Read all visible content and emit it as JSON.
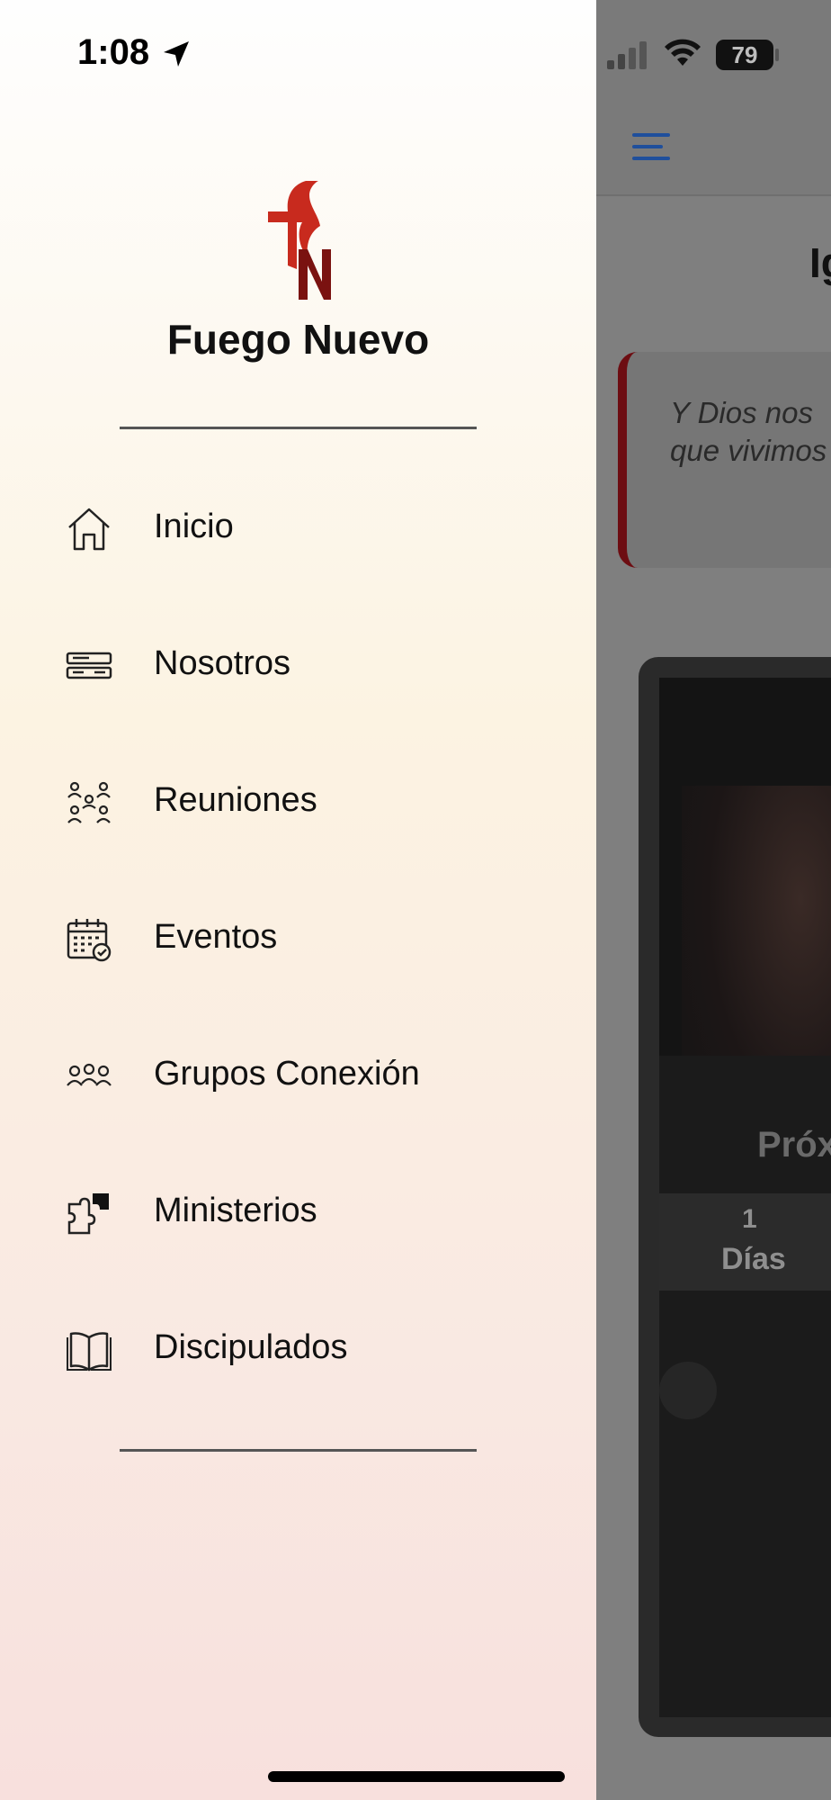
{
  "status_bar": {
    "time": "1:08",
    "battery": "79"
  },
  "drawer": {
    "brand_name": "Fuego Nuevo",
    "menu": [
      {
        "label": "Inicio",
        "icon": "home-icon"
      },
      {
        "label": "Nosotros",
        "icon": "about-icon"
      },
      {
        "label": "Reuniones",
        "icon": "people-network-icon"
      },
      {
        "label": "Eventos",
        "icon": "calendar-check-icon"
      },
      {
        "label": "Grupos Conexión",
        "icon": "group-icon"
      },
      {
        "label": "Ministerios",
        "icon": "puzzle-icon"
      },
      {
        "label": "Discipulados",
        "icon": "book-icon"
      }
    ]
  },
  "background_page": {
    "title_fragment": "Ig",
    "quote_line1": "Y Dios nos",
    "quote_line2": "que vivimos",
    "countdown_title": "Próx",
    "countdown_value": "1",
    "countdown_unit": "Días"
  },
  "colors": {
    "accent_blue": "#1f4f9c",
    "brand_red": "#c82a1e",
    "brand_dark_red": "#7a1210"
  }
}
